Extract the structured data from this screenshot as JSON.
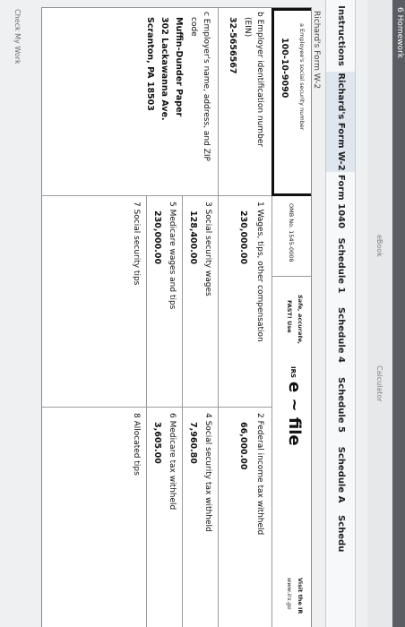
{
  "header": {
    "title": "6 Homework",
    "links": [
      "eBook",
      "Calculator"
    ]
  },
  "tabs": [
    {
      "label": "Instructions"
    },
    {
      "label": "Richard's Form W-2"
    },
    {
      "label": "Form 1040"
    },
    {
      "label": "Schedule 1"
    },
    {
      "label": "Schedule 4"
    },
    {
      "label": "Schedule 5"
    },
    {
      "label": "Schedule A"
    },
    {
      "label": "Schedu"
    }
  ],
  "form_title": "Richard's Form W-2",
  "w2": {
    "a_label": "a Employee's social security number",
    "a_value": "100-10-9090",
    "omb": "OMB No. 1545-0008",
    "safe": "Safe, accurate,",
    "fast": "FAST! Use",
    "irs": "IRS",
    "efile": "e ~ file",
    "visit": "Visit the IR",
    "visit2": "www.irs.go",
    "b_label": "b Employer identification number",
    "b_label2": "(EIN)",
    "b_value": "32-5656567",
    "c_label": "c Employer's name, address, and ZIP",
    "c_label2": "code",
    "c_line1": "Muffin-Dunder Paper",
    "c_line2": "302 Lackawanna Ave.",
    "c_line3": "Scranton, PA 18503",
    "box1_label": "1 Wages, tips, other compensation",
    "box1_value": "230,000.00",
    "box2_label": "2 Federal income tax withheld",
    "box2_value": "66,000.00",
    "box3_label": "3 Social security wages",
    "box3_value": "128,400.00",
    "box4_label": "4 Social security tax withheld",
    "box4_value": "7,960.80",
    "box5_label": "5 Medicare wages and tips",
    "box5_value": "230,000.00",
    "box6_label": "6 Medicare tax withheld",
    "box6_value": "3,605.00",
    "box7_label": "7 Social security tips",
    "box8_label": "8 Allocated tips"
  },
  "footer": {
    "check": "Check My Work"
  }
}
